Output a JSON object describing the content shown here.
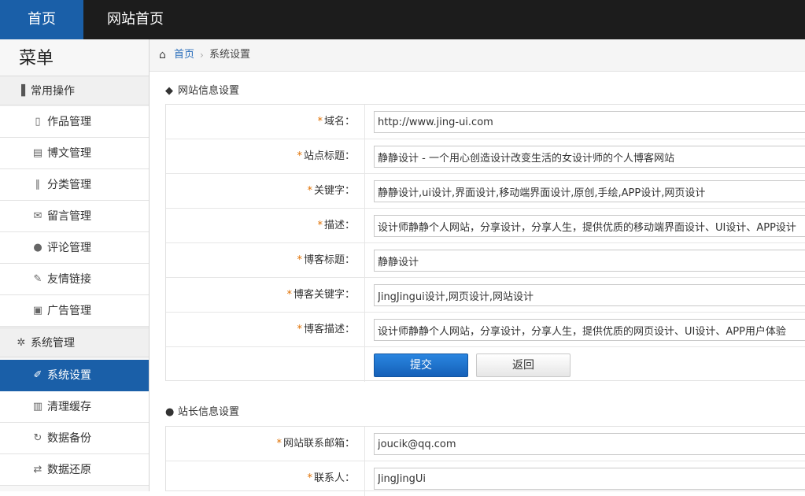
{
  "topbar": {
    "home": "首页",
    "site_home": "网站首页"
  },
  "sidebar": {
    "title": "菜单",
    "groups": [
      {
        "label": "常用操作",
        "icon": "book-icon",
        "items": [
          {
            "label": "作品管理",
            "icon": "file-icon"
          },
          {
            "label": "博文管理",
            "icon": "document-icon"
          },
          {
            "label": "分类管理",
            "icon": "library-icon"
          },
          {
            "label": "留言管理",
            "icon": "envelope-icon"
          },
          {
            "label": "评论管理",
            "icon": "comment-icon"
          },
          {
            "label": "友情链接",
            "icon": "plug-icon"
          },
          {
            "label": "广告管理",
            "icon": "picture-icon"
          }
        ]
      },
      {
        "label": "系统管理",
        "icon": "gear-icon",
        "items": [
          {
            "label": "系统设置",
            "icon": "wrench-icon",
            "active": true
          },
          {
            "label": "清理缓存",
            "icon": "trash-icon"
          },
          {
            "label": "数据备份",
            "icon": "refresh-icon"
          },
          {
            "label": "数据还原",
            "icon": "sync-icon"
          }
        ]
      }
    ]
  },
  "breadcrumb": {
    "home": "首页",
    "separator": "›",
    "current": "系统设置"
  },
  "site_info": {
    "title": "网站信息设置",
    "icon": "tag-icon",
    "fields": [
      {
        "label": "域名：",
        "value": "http://www.jing-ui.com"
      },
      {
        "label": "站点标题：",
        "value": "静静设计 - 一个用心创造设计改变生活的女设计师的个人博客网站"
      },
      {
        "label": "关键字：",
        "value": "静静设计,ui设计,界面设计,移动端界面设计,原创,手绘,APP设计,网页设计"
      },
      {
        "label": "描述：",
        "value": "设计师静静个人网站，分享设计，分享人生，提供优质的移动端界面设计、UI设计、APP设计"
      },
      {
        "label": "博客标题：",
        "value": "静静设计"
      },
      {
        "label": "博客关键字：",
        "value": "JingJingui设计,网页设计,网站设计"
      },
      {
        "label": "博客描述：",
        "value": "设计师静静个人网站，分享设计，分享人生，提供优质的网页设计、UI设计、APP用户体验"
      }
    ],
    "submit_label": "提交",
    "back_label": "返回"
  },
  "owner_info": {
    "title": "站长信息设置",
    "icon": "user-icon",
    "fields": [
      {
        "label": "网站联系邮箱：",
        "value": "joucik@qq.com"
      },
      {
        "label": "联系人：",
        "value": "JingJingUi"
      }
    ]
  },
  "colors": {
    "accent": "#1a5fa8",
    "topbar": "#1c1c1c",
    "required": "#e07000",
    "link": "#2a6ebb"
  }
}
